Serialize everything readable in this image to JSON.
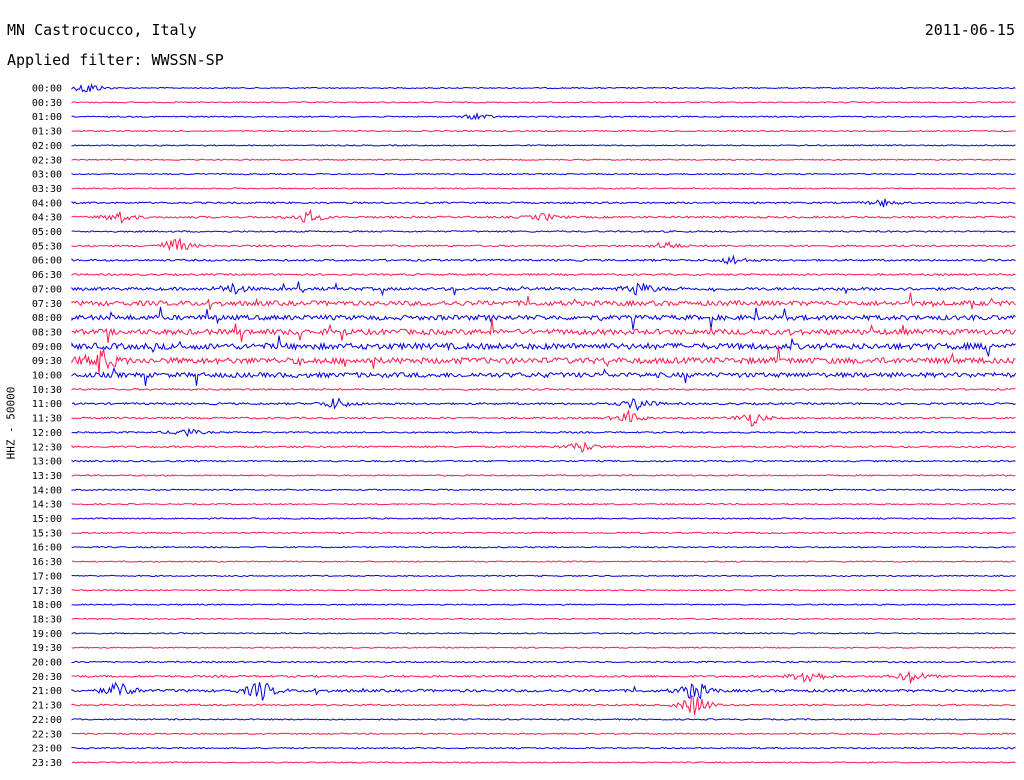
{
  "header": {
    "station": "MN Castrocucco, Italy",
    "date": "2011-06-15",
    "filter": "Applied filter: WWSSN-SP"
  },
  "chart_data": {
    "type": "line",
    "title": "MN Castrocucco, Italy",
    "ylabel": "HHZ - 50000",
    "row_labels": [
      "00:00",
      "00:30",
      "01:00",
      "01:30",
      "02:00",
      "02:30",
      "03:00",
      "03:30",
      "04:00",
      "04:30",
      "05:00",
      "05:30",
      "06:00",
      "06:30",
      "07:00",
      "07:30",
      "08:00",
      "08:30",
      "09:00",
      "09:30",
      "10:00",
      "10:30",
      "11:00",
      "11:30",
      "12:00",
      "12:30",
      "13:00",
      "13:30",
      "14:00",
      "14:30",
      "15:00",
      "15:30",
      "16:00",
      "16:30",
      "17:00",
      "17:30",
      "18:00",
      "18:30",
      "19:00",
      "19:30",
      "20:00",
      "20:30",
      "21:00",
      "21:30",
      "22:00",
      "22:30",
      "23:00",
      "23:30"
    ],
    "colors": {
      "even_rows": "#0000e6",
      "odd_rows": "#ff1a4b"
    },
    "row_noise_level": [
      1,
      1,
      1,
      1,
      1,
      1,
      1,
      1,
      1.4,
      1.6,
      1.3,
      1.4,
      1.6,
      1.5,
      2.5,
      4,
      4,
      4.5,
      5,
      5,
      4,
      1.4,
      1.6,
      1.5,
      1.3,
      1.5,
      1.3,
      1.1,
      1.1,
      1.1,
      1.1,
      1.1,
      1.1,
      1,
      1,
      1,
      1,
      1,
      1,
      1,
      1.2,
      1.6,
      2.2,
      1.3,
      1.1,
      1.1,
      1.1,
      1
    ],
    "events": [
      {
        "row": "00:00",
        "time_frac": 0.017,
        "amplitude": 7
      },
      {
        "row": "01:00",
        "time_frac": 0.43,
        "amplitude": 4
      },
      {
        "row": "04:00",
        "time_frac": 0.86,
        "amplitude": 4
      },
      {
        "row": "04:30",
        "time_frac": 0.05,
        "amplitude": 7
      },
      {
        "row": "04:30",
        "time_frac": 0.25,
        "amplitude": 8
      },
      {
        "row": "04:30",
        "time_frac": 0.5,
        "amplitude": 4
      },
      {
        "row": "05:30",
        "time_frac": 0.11,
        "amplitude": 10
      },
      {
        "row": "05:30",
        "time_frac": 0.63,
        "amplitude": 5
      },
      {
        "row": "06:00",
        "time_frac": 0.7,
        "amplitude": 5
      },
      {
        "row": "07:00",
        "time_frac": 0.17,
        "amplitude": 6
      },
      {
        "row": "07:00",
        "time_frac": 0.6,
        "amplitude": 8
      },
      {
        "row": "09:30",
        "time_frac": 0.03,
        "amplitude": 14
      },
      {
        "row": "11:00",
        "time_frac": 0.28,
        "amplitude": 7
      },
      {
        "row": "11:00",
        "time_frac": 0.6,
        "amplitude": 8
      },
      {
        "row": "11:30",
        "time_frac": 0.59,
        "amplitude": 7
      },
      {
        "row": "11:30",
        "time_frac": 0.72,
        "amplitude": 8
      },
      {
        "row": "12:00",
        "time_frac": 0.12,
        "amplitude": 5
      },
      {
        "row": "12:30",
        "time_frac": 0.54,
        "amplitude": 6
      },
      {
        "row": "20:30",
        "time_frac": 0.78,
        "amplitude": 10
      },
      {
        "row": "20:30",
        "time_frac": 0.89,
        "amplitude": 8
      },
      {
        "row": "21:00",
        "time_frac": 0.05,
        "amplitude": 10
      },
      {
        "row": "21:00",
        "time_frac": 0.2,
        "amplitude": 12
      },
      {
        "row": "21:00",
        "time_frac": 0.66,
        "amplitude": 12
      },
      {
        "row": "21:30",
        "time_frac": 0.66,
        "amplitude": 14
      }
    ]
  }
}
